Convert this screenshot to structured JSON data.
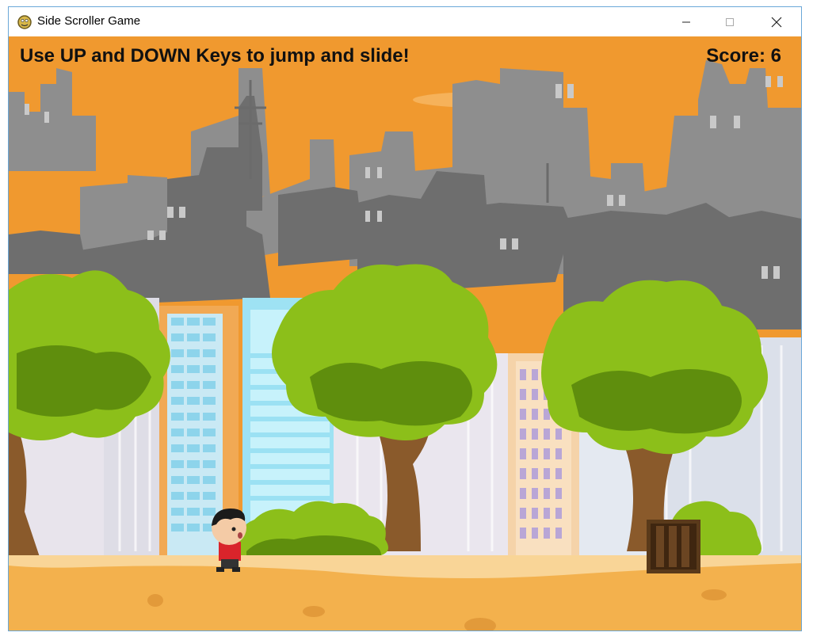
{
  "window": {
    "title": "Side Scroller Game",
    "app_icon": "pygame-snake-icon",
    "controls": [
      "minimize-icon",
      "maximize-icon",
      "close-icon"
    ]
  },
  "hud": {
    "instructions": "Use UP and DOWN Keys to jump and slide!",
    "score_label": "Score: 6"
  },
  "colors": {
    "sky": "#f0992f",
    "ground": "#f3b14d",
    "ground_highlight": "#f9d597",
    "ruins_back": "#8f8f8f",
    "ruins_front": "#6b6b6b",
    "tree_foliage": "#8cbf1a",
    "tree_trunk": "#8a5a2b",
    "crate": "#5a3a1a"
  },
  "sprites": {
    "player": "boy-runner-sprite",
    "obstacle": "wooden-crate"
  }
}
